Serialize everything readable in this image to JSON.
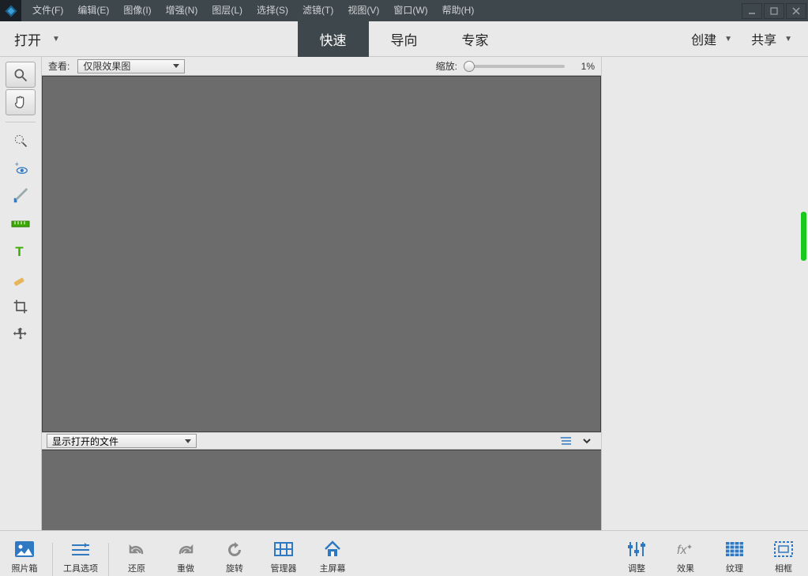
{
  "menu": {
    "items": [
      "文件(F)",
      "编辑(E)",
      "图像(I)",
      "增强(N)",
      "图层(L)",
      "选择(S)",
      "滤镜(T)",
      "视图(V)",
      "窗口(W)",
      "帮助(H)"
    ]
  },
  "modebar": {
    "open": "打开",
    "tabs": [
      "快速",
      "导向",
      "专家"
    ],
    "active_tab": 0,
    "create": "创建",
    "share": "共享"
  },
  "options": {
    "view_label": "查看:",
    "view_value": "仅限效果图",
    "zoom_label": "缩放:",
    "zoom_value": "1%"
  },
  "dock": {
    "show_open_files": "显示打开的文件"
  },
  "panelbar": {
    "left": [
      {
        "id": "photobin",
        "label": "照片箱"
      },
      {
        "id": "tooloptions",
        "label": "工具选项"
      },
      {
        "id": "undo",
        "label": "还原"
      },
      {
        "id": "redo",
        "label": "重做"
      },
      {
        "id": "rotate",
        "label": "旋转"
      },
      {
        "id": "organizer",
        "label": "管理器"
      },
      {
        "id": "home",
        "label": "主屏幕"
      }
    ],
    "right": [
      {
        "id": "adjust",
        "label": "调整"
      },
      {
        "id": "effects",
        "label": "效果"
      },
      {
        "id": "textures",
        "label": "纹理"
      },
      {
        "id": "frames",
        "label": "相框"
      }
    ]
  },
  "tools": {
    "items": [
      {
        "id": "zoom",
        "name": "zoom-tool"
      },
      {
        "id": "hand",
        "name": "hand-tool"
      },
      {
        "id": "quick-select",
        "name": "quick-select-tool"
      },
      {
        "id": "redeye",
        "name": "redeye-tool"
      },
      {
        "id": "whiten",
        "name": "whiten-teeth-tool"
      },
      {
        "id": "straighten",
        "name": "straighten-tool"
      },
      {
        "id": "text",
        "name": "text-tool"
      },
      {
        "id": "spot-heal",
        "name": "spot-heal-tool"
      },
      {
        "id": "crop",
        "name": "crop-tool"
      },
      {
        "id": "move",
        "name": "move-tool"
      }
    ]
  }
}
